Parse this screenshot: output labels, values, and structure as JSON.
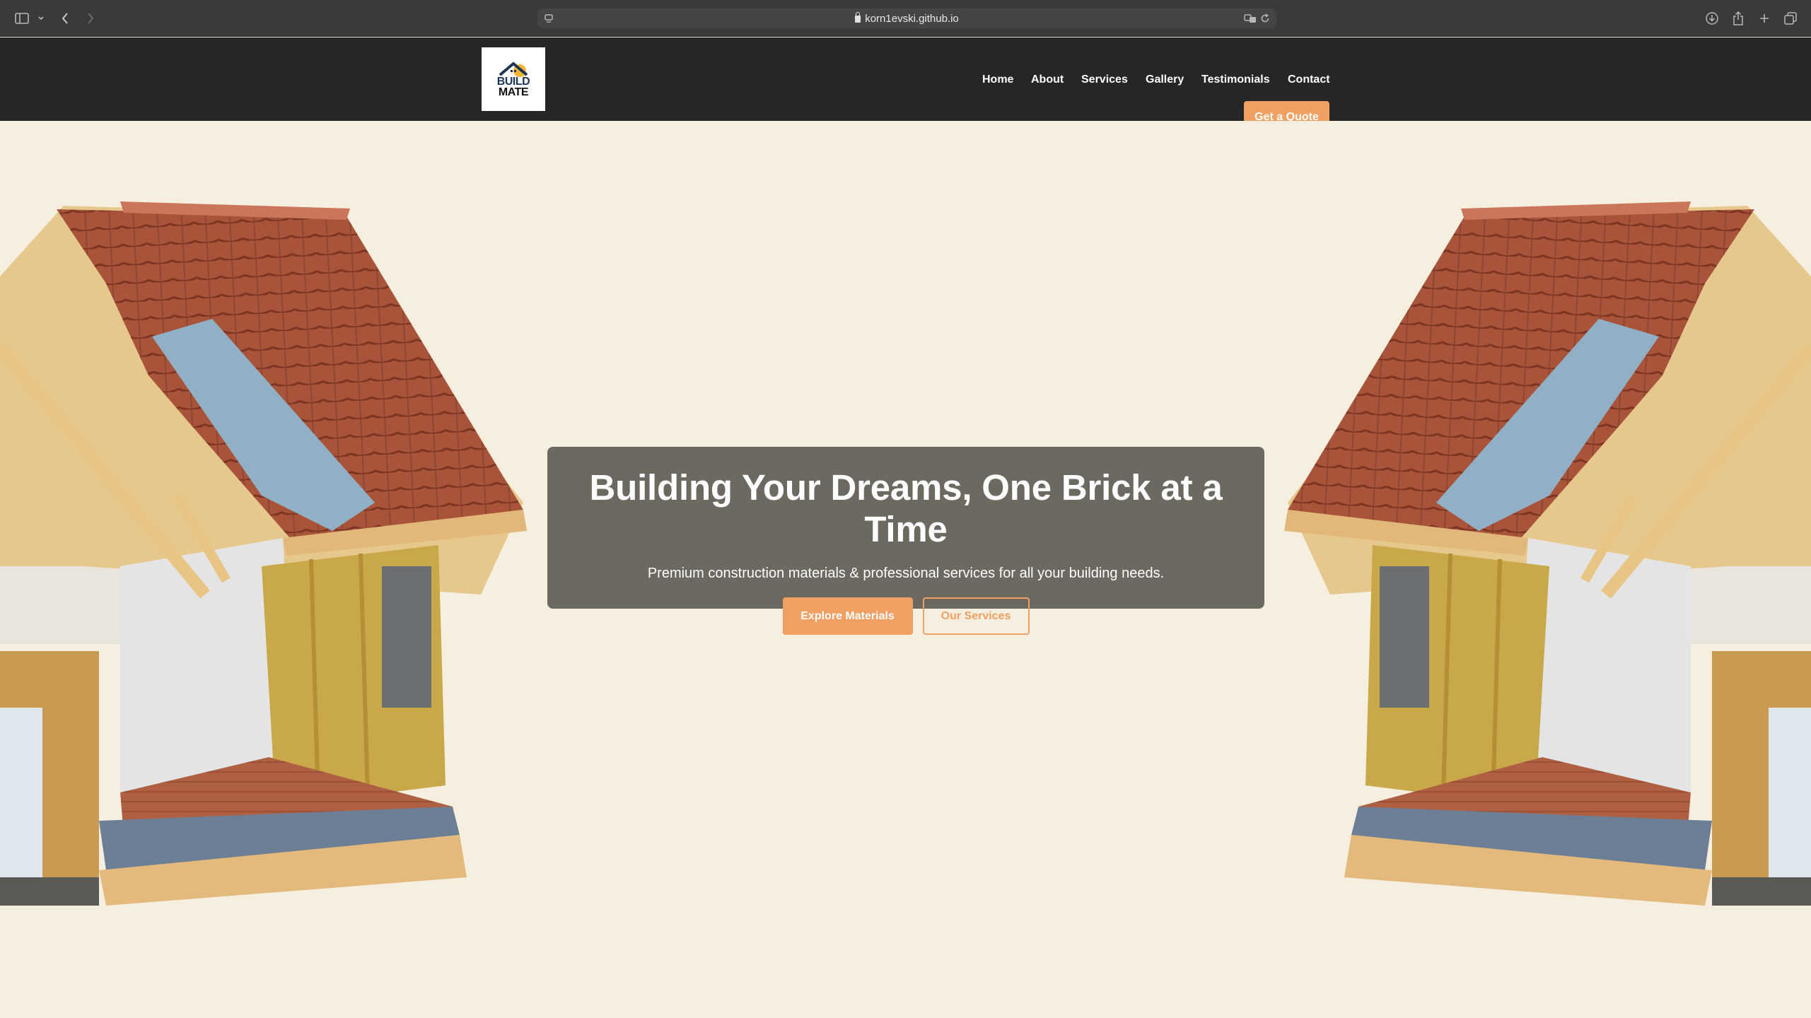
{
  "browser": {
    "url": "korn1evski.github.io"
  },
  "nav": {
    "items": [
      {
        "label": "Home"
      },
      {
        "label": "About"
      },
      {
        "label": "Services"
      },
      {
        "label": "Gallery"
      },
      {
        "label": "Testimonials"
      },
      {
        "label": "Contact"
      }
    ],
    "quote_label": "Get a Quote"
  },
  "logo": {
    "line1": "BUILD",
    "line2": "MATE"
  },
  "hero": {
    "title": "Building Your Dreams, One Brick at a Time",
    "subtitle": "Premium construction materials & professional services for all your building needs.",
    "primary_button": "Explore Materials",
    "secondary_button": "Our Services"
  },
  "colors": {
    "accent": "#f0a063",
    "header_bg": "#262626",
    "hero_bg": "#f6efe0",
    "hero_box": "#6c6960"
  }
}
